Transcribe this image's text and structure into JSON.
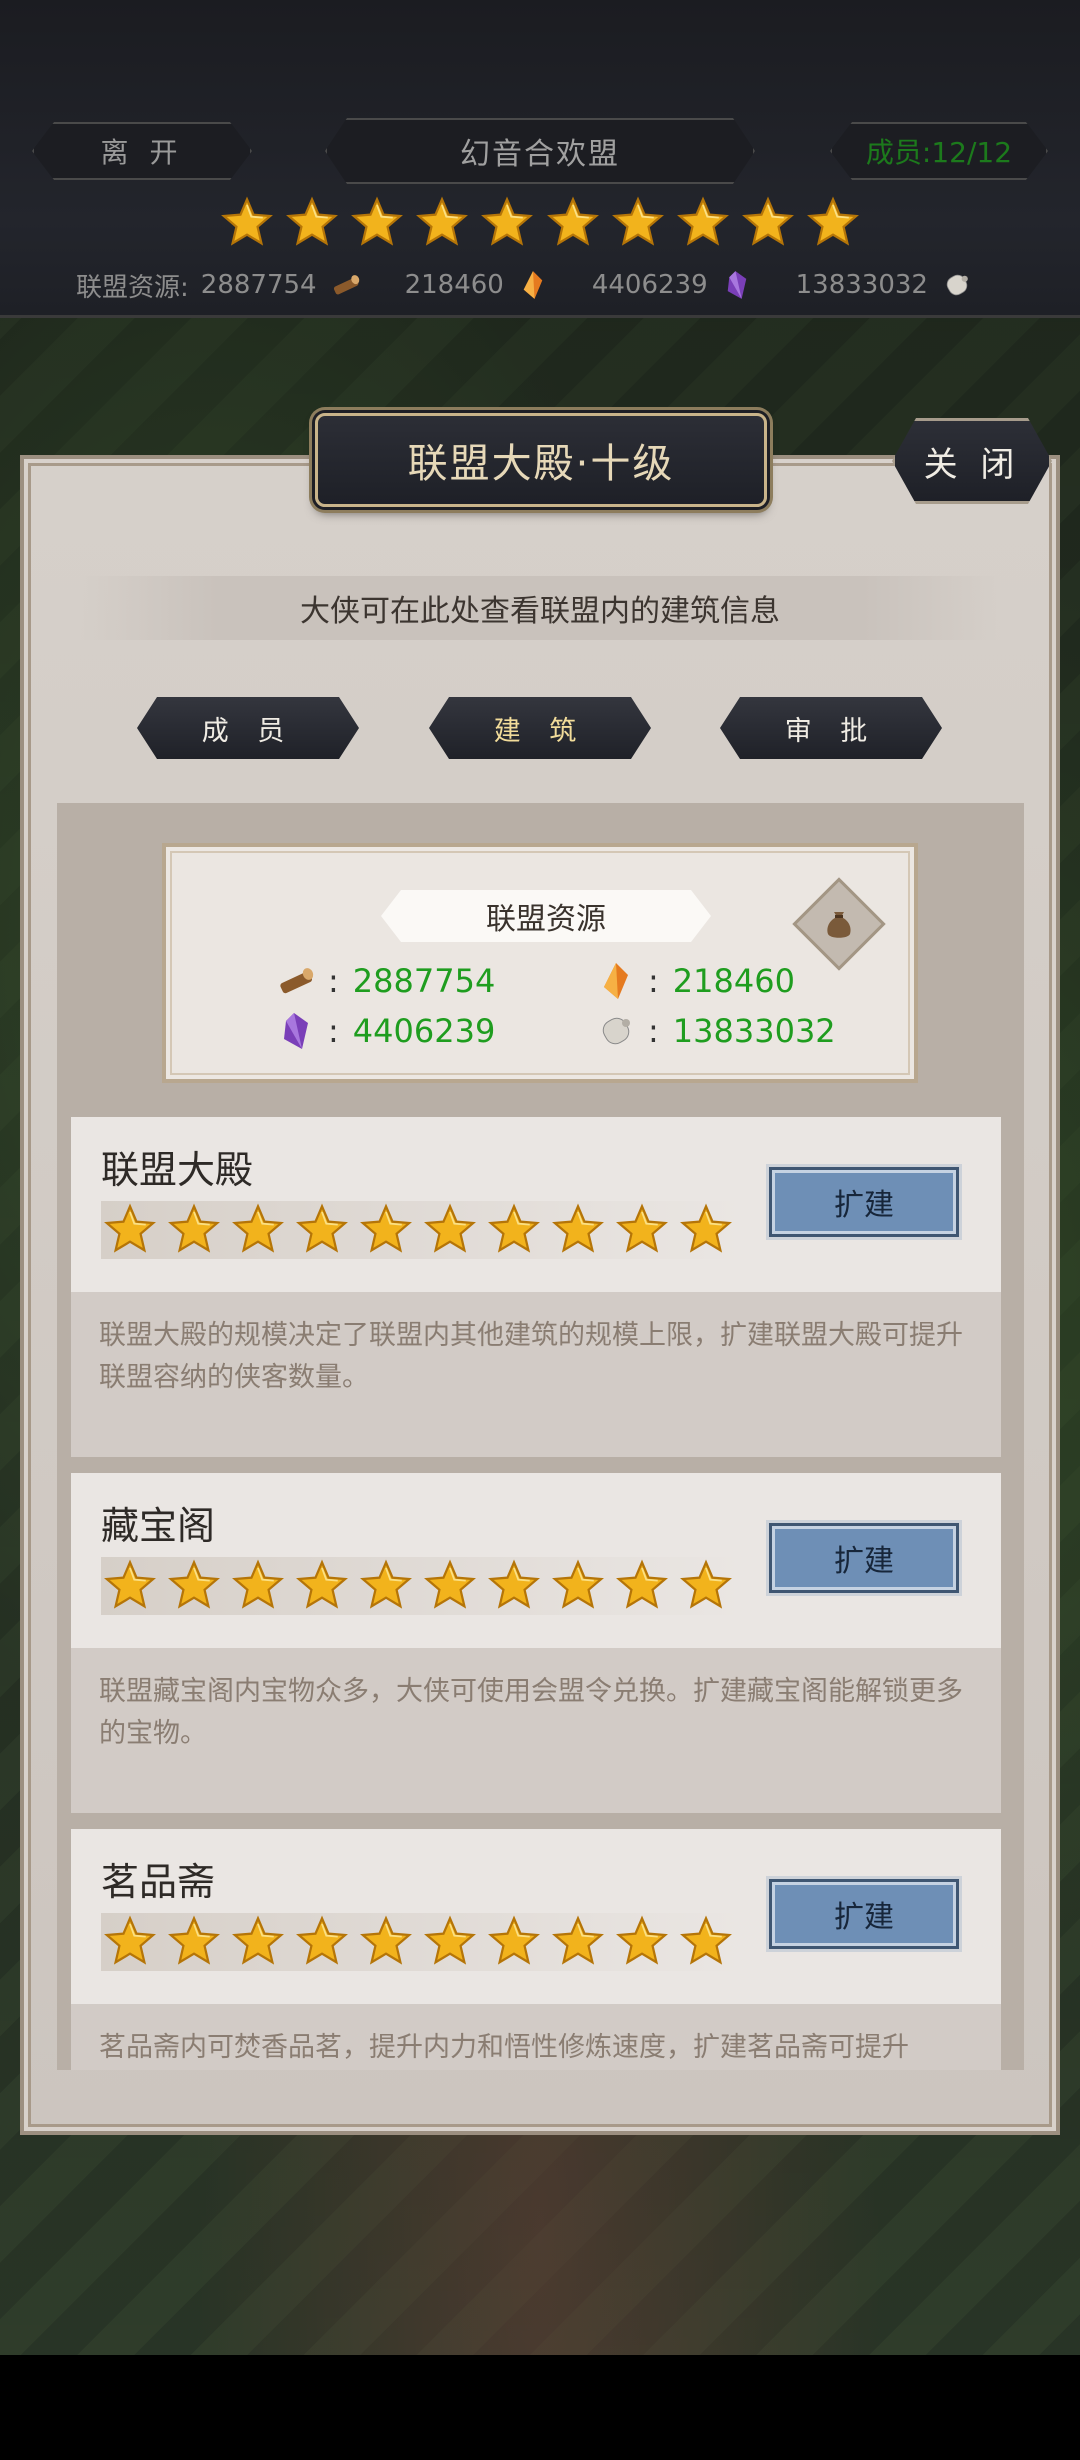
{
  "header": {
    "leave_label": "离 开",
    "alliance_name": "幻音合欢盟",
    "members_label": "成员:12/12",
    "star_count": 10,
    "resources_label": "联盟资源:",
    "resources": [
      "2887754",
      "218460",
      "4406239",
      "13833032"
    ]
  },
  "panel": {
    "title": "联盟大殿·十级",
    "close_label": "关 闭",
    "intro": "大侠可在此处查看联盟内的建筑信息"
  },
  "tabs": [
    {
      "label": "成 员",
      "active": false
    },
    {
      "label": "建 筑",
      "active": true
    },
    {
      "label": "审 批",
      "active": false
    }
  ],
  "resource_card": {
    "title": "联盟资源",
    "items": [
      {
        "icon": "wood-icon",
        "value": "2887754"
      },
      {
        "icon": "crystal-orange-icon",
        "value": "218460"
      },
      {
        "icon": "crystal-purple-icon",
        "value": "4406239"
      },
      {
        "icon": "scroll-icon",
        "value": "13833032"
      }
    ]
  },
  "buildings": [
    {
      "name": "联盟大殿",
      "stars": 10,
      "button": "扩建",
      "desc": "联盟大殿的规模决定了联盟内其他建筑的规模上限，扩建联盟大殿可提升联盟容纳的侠客数量。"
    },
    {
      "name": "藏宝阁",
      "stars": 10,
      "button": "扩建",
      "desc": "联盟藏宝阁内宝物众多，大侠可使用会盟令兑换。扩建藏宝阁能解锁更多的宝物。"
    },
    {
      "name": "茗品斋",
      "stars": 10,
      "button": "扩建",
      "desc": "茗品斋内可焚香品茗，提升内力和悟性修炼速度，扩建茗品斋可提升"
    }
  ],
  "colors": {
    "star": "#f2b31c",
    "resource_value": "#1f9d1f",
    "button_blue": "#6e8fb6"
  }
}
